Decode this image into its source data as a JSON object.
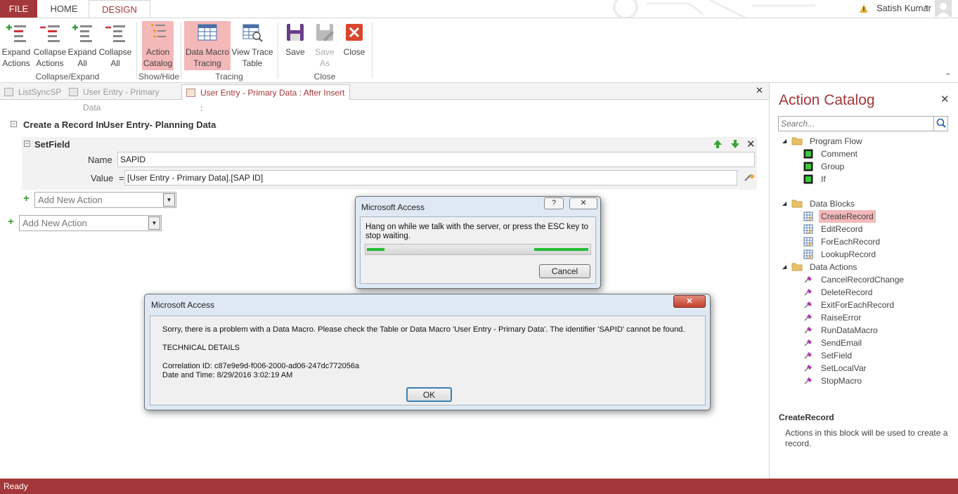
{
  "ribbon": {
    "tabs": {
      "file": "FILE",
      "home": "HOME",
      "design": "DESIGN"
    },
    "user": "Satish Kumar",
    "buttons": {
      "expand_actions": "Expand\nActions",
      "collapse_actions": "Collapse\nActions",
      "expand_all": "Expand\nAll",
      "collapse_all": "Collapse\nAll",
      "action_catalog": "Action\nCatalog",
      "data_macro_tracing": "Data Macro\nTracing",
      "view_trace_table": "View Trace\nTable",
      "save": "Save",
      "save_as": "Save\nAs",
      "close": "Close"
    },
    "groups": {
      "collapse_expand": "Collapse/Expand",
      "show_hide": "Show/Hide",
      "tracing": "Tracing",
      "close": "Close"
    }
  },
  "doc_tabs": [
    "ListSyncSP",
    "User Entry - Primary Data",
    "User Entry - Primary Data : After Insert :"
  ],
  "macro": {
    "create_record_label": "Create a Record In",
    "create_record_target": "User Entry- Planning Data",
    "setfield_label": "SetField",
    "name_label": "Name",
    "name_value": "SAPID",
    "value_label": "Value",
    "value_equals": "=",
    "value_value": "[User Entry - Primary Data].[SAP ID]",
    "add_new_action_inner": "Add New Action",
    "add_new_action_outer": "Add New Action"
  },
  "catalog": {
    "title": "Action Catalog",
    "search_placeholder": "Search...",
    "groups": [
      {
        "label": "Program Flow",
        "items": [
          "Comment",
          "Group",
          "If"
        ]
      },
      {
        "label": "Data Blocks",
        "items": [
          "CreateRecord",
          "EditRecord",
          "ForEachRecord",
          "LookupRecord"
        ]
      },
      {
        "label": "Data Actions",
        "items": [
          "CancelRecordChange",
          "DeleteRecord",
          "ExitForEachRecord",
          "RaiseError",
          "RunDataMacro",
          "SendEmail",
          "SetField",
          "SetLocalVar",
          "StopMacro"
        ]
      }
    ],
    "selected": "CreateRecord",
    "desc_title": "CreateRecord",
    "desc_text": "Actions in this block will be used to create a record."
  },
  "status": {
    "text": "Ready"
  },
  "wait_dialog": {
    "title": "Microsoft Access",
    "message": "Hang on while we talk with the server, or press the ESC key to stop waiting.",
    "cancel_label": "Cancel",
    "help_label": "?"
  },
  "error_dialog": {
    "title": "Microsoft Access",
    "message": "Sorry, there is a problem with a Data Macro. Please check the Table or Data Macro 'User Entry - Primary Data'. The identifier 'SAPID' cannot be found.",
    "tech_header": "TECHNICAL DETAILS",
    "correlation": "Correlation ID: c87e9e9d-f006-2000-ad06-247dc772056a",
    "datetime": "Date and Time: 8/29/2016 3:02:19 AM",
    "ok_label": "OK"
  },
  "colors": {
    "accent": "#a4373a",
    "active_highlight": "#f4b8b9"
  }
}
